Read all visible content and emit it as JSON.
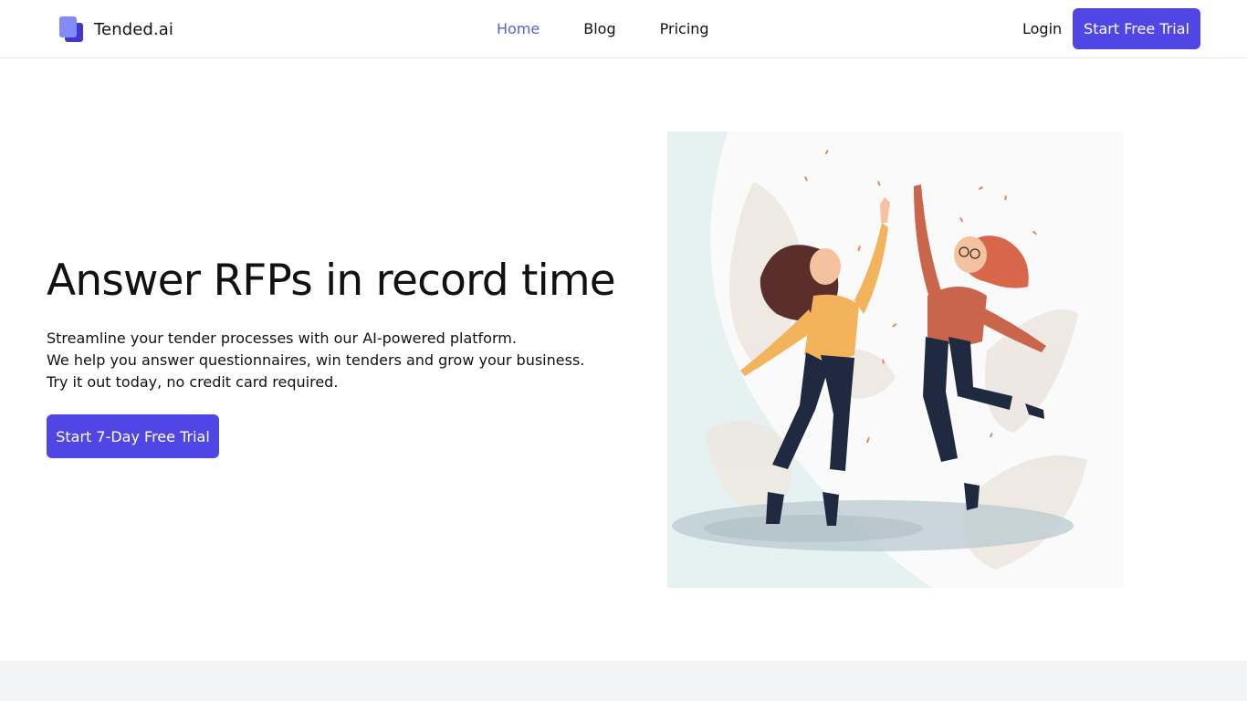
{
  "brand": {
    "name": "Tended.ai",
    "logo_icon": "stacked-pages-logo"
  },
  "nav": {
    "links": [
      {
        "label": "Home",
        "active": true
      },
      {
        "label": "Blog",
        "active": false
      },
      {
        "label": "Pricing",
        "active": false
      }
    ],
    "login_label": "Login",
    "cta_label": "Start Free Trial"
  },
  "hero": {
    "title": "Answer RFPs in record time",
    "lines": [
      "Streamline your tender processes with our AI-powered platform.",
      "We help you answer questionnaires, win tenders and grow your business.",
      "Try it out today, no credit card required."
    ],
    "cta_label": "Start 7-Day Free Trial"
  },
  "colors": {
    "accent": "#4f46e5",
    "active_link": "#5b5fd6",
    "footer_band": "#f3f4f6"
  }
}
